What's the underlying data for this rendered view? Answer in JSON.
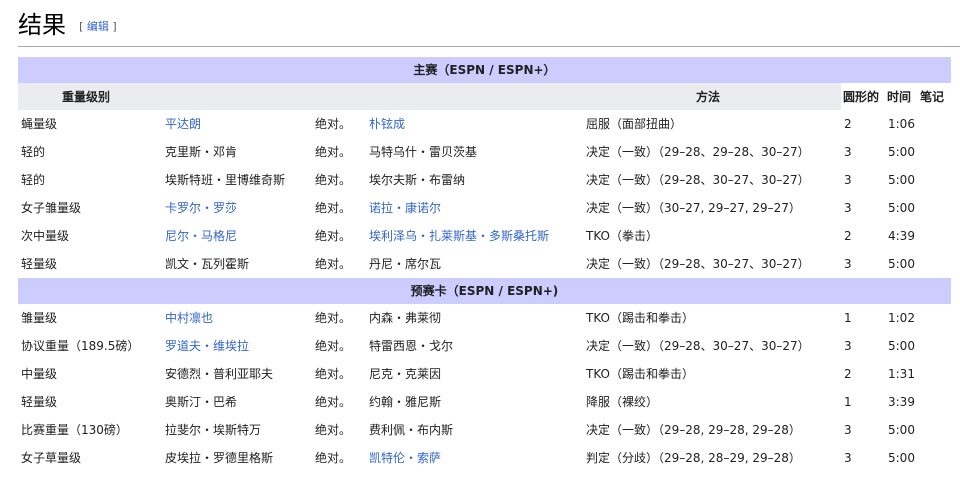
{
  "section": {
    "title": "结果",
    "edit_open": "[ ",
    "edit_label": "编辑",
    "edit_close": " ]"
  },
  "table": {
    "main_card_title": "主赛（ESPN / ESPN+）",
    "prelim_card_title": "预赛卡（ESPN / ESPN+)",
    "headers": {
      "weight": "重量级别",
      "method": "方法",
      "round": "圆形的",
      "time": "时间",
      "notes": "笔记"
    },
    "main_card": [
      {
        "weight": "蝇量级",
        "fighter1": "平达朗",
        "f1_link": true,
        "result": "绝对。",
        "fighter2": "朴铉成",
        "f2_link": true,
        "method": "屈服（面部扭曲）",
        "round": "2",
        "time": "1:06"
      },
      {
        "weight": "轻的",
        "fighter1": "克里斯・邓肯",
        "f1_link": false,
        "result": "绝对。",
        "fighter2": "马特乌什・雷贝茨基",
        "f2_link": false,
        "method": "决定（一致）（29–28、29–28、30–27）",
        "round": "3",
        "time": "5:00"
      },
      {
        "weight": "轻的",
        "fighter1": "埃斯特班・里博维奇斯",
        "f1_link": false,
        "result": "绝对。",
        "fighter2": "埃尔夫斯・布雷纳",
        "f2_link": false,
        "method": "决定（一致）（29–28、30–27、30–27）",
        "round": "3",
        "time": "5:00"
      },
      {
        "weight": "女子雏量级",
        "fighter1": "卡罗尔・罗莎",
        "f1_link": true,
        "result": "绝对。",
        "fighter2": "诺拉・康诺尔",
        "f2_link": true,
        "method": "决定（一致）（30–27, 29–27, 29–27）",
        "round": "3",
        "time": "5:00"
      },
      {
        "weight": "次中量级",
        "fighter1": "尼尔・马格尼",
        "f1_link": true,
        "result": "绝对。",
        "fighter2": "埃利泽乌・扎莱斯基・多斯桑托斯",
        "f2_link": true,
        "method": "TKO（拳击）",
        "round": "2",
        "time": "4:39"
      },
      {
        "weight": "轻量级",
        "fighter1": "凯文・瓦列霍斯",
        "f1_link": false,
        "result": "绝对。",
        "fighter2": "丹尼・席尔瓦",
        "f2_link": false,
        "method": "决定（一致）（29–28、30–27、30–27）",
        "round": "3",
        "time": "5:00"
      }
    ],
    "prelim_card": [
      {
        "weight": "雏量级",
        "fighter1": "中村凛也",
        "f1_link": true,
        "result": "绝对。",
        "fighter2": "内森・弗莱彻",
        "f2_link": false,
        "method": "TKO（踢击和拳击）",
        "round": "1",
        "time": "1:02"
      },
      {
        "weight": "协议重量（189.5磅）",
        "fighter1": "罗道夫・维埃拉",
        "f1_link": true,
        "result": "绝对。",
        "fighter2": "特雷西恩・戈尔",
        "f2_link": false,
        "method": "决定（一致）（29–28、30–27、30–27）",
        "round": "3",
        "time": "5:00"
      },
      {
        "weight": "中量级",
        "fighter1": "安德烈・普利亚耶夫",
        "f1_link": false,
        "result": "绝对。",
        "fighter2": "尼克・克莱因",
        "f2_link": false,
        "method": "TKO（踢击和拳击）",
        "round": "2",
        "time": "1:31"
      },
      {
        "weight": "轻量级",
        "fighter1": "奥斯汀・巴希",
        "f1_link": false,
        "result": "绝对。",
        "fighter2": "约翰・雅尼斯",
        "f2_link": false,
        "method": "降服（裸绞）",
        "round": "1",
        "time": "3:39"
      },
      {
        "weight": "比赛重量（130磅）",
        "fighter1": "拉斐尔・埃斯特万",
        "f1_link": false,
        "result": "绝对。",
        "fighter2": "费利佩・布内斯",
        "f2_link": false,
        "method": "决定（一致）（29–28, 29–28, 29–28）",
        "round": "3",
        "time": "5:00"
      },
      {
        "weight": "女子草量级",
        "fighter1": "皮埃拉・罗德里格斯",
        "f1_link": false,
        "result": "绝对。",
        "fighter2": "凯特伦・索萨",
        "f2_link": true,
        "method": "判定（分歧）（29–28, 28–29, 29–28）",
        "round": "3",
        "time": "5:00"
      }
    ]
  }
}
